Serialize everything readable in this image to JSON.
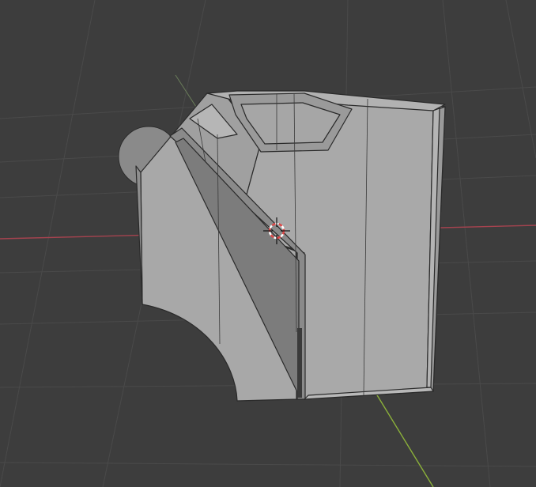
{
  "viewport": {
    "background": "#3d3d3d",
    "grid_color": "#4a4a4a",
    "axis_x_color": "#a5434f",
    "axis_y_color": "#8cb13a",
    "axis_z_color": "#6a7d5a"
  },
  "model": {
    "face_light": "#a9a9a9",
    "face_mid": "#9c9c9c",
    "face_dark": "#8e8e8e",
    "edge_color": "#2a2a2a",
    "sphere_color": "#8a8a8a"
  },
  "cursor": {
    "ring_color": "#e04848",
    "ring_secondary": "#ffffff",
    "crosshair_color": "#111111",
    "icon": "3d-cursor-icon"
  }
}
